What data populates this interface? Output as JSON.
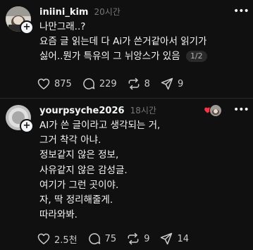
{
  "posts": [
    {
      "username": "iniini_kim",
      "time": "20시간",
      "text_lines": [
        "나만그래..?",
        "요즘 글 읽는데 다 Ai가 쓴거같아서 읽기가",
        "싫어..뭔가 특유의 그 뉘앙스가 있음"
      ],
      "page_indicator": "1/2",
      "actions": {
        "likes": "875",
        "comments": "229",
        "reposts": "8",
        "shares": "9"
      },
      "icons": [
        "heart-icon",
        "comment-icon",
        "repost-icon",
        "share-icon"
      ]
    },
    {
      "username": "yourpsyche2026",
      "time": "18시간",
      "text_lines": [
        "AI가 쓴 글이라고 생각되는 거,",
        "그거 착각 아냐.",
        "정보같지 않은 정보,",
        "사유같지 않은 감성글.",
        "여기가 그런 곳이야.",
        "자, 딱 정리해줄게.",
        "따라와봐."
      ],
      "actions": {
        "likes": "2.5천",
        "comments": "75",
        "reposts": "9",
        "shares": "14"
      },
      "icons": [
        "heart-icon",
        "comment-icon",
        "repost-icon",
        "share-icon"
      ]
    }
  ],
  "colors": {
    "background": "#101010",
    "text": "#f3f5f7",
    "muted": "#777777",
    "heart_reaction": "#ff3040"
  }
}
